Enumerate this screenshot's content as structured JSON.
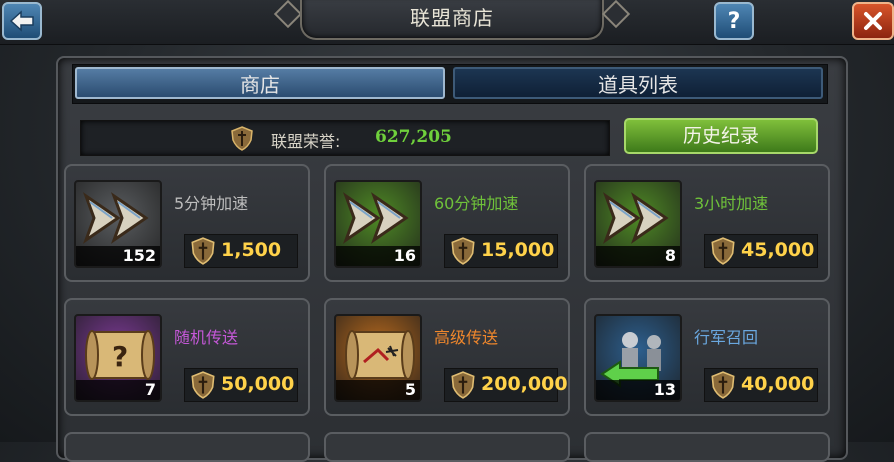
{
  "header": {
    "title": "联盟商店"
  },
  "tabs": [
    {
      "label": "商店",
      "active": true
    },
    {
      "label": "道具列表",
      "active": false
    }
  ],
  "honor": {
    "label": "联盟荣誉:",
    "value": "627,205"
  },
  "history_button": {
    "label": "历史纪录"
  },
  "colors": {
    "honor_value": "#6fd03c",
    "price": "#ffd24a",
    "tab_active": "#3e648c",
    "history": "#5f9f2c"
  },
  "items": [
    {
      "name": "5分钟加速",
      "price": "1,500",
      "quantity": "152",
      "icon": "fast-forward-icon",
      "name_color": "#bdbdbd",
      "bg": "#5a5d60"
    },
    {
      "name": "60分钟加速",
      "price": "15,000",
      "quantity": "16",
      "icon": "fast-forward-icon",
      "name_color": "#6fc23a",
      "bg": "#4f8a25"
    },
    {
      "name": "3小时加速",
      "price": "45,000",
      "quantity": "8",
      "icon": "fast-forward-icon",
      "name_color": "#6fc23a",
      "bg": "#4f8a25"
    },
    {
      "name": "随机传送",
      "price": "50,000",
      "quantity": "7",
      "icon": "scroll-question-icon",
      "name_color": "#c558d8",
      "bg": "#7b3a95"
    },
    {
      "name": "高级传送",
      "price": "200,000",
      "quantity": "5",
      "icon": "scroll-map-icon",
      "name_color": "#f0872c",
      "bg": "#b86a1e"
    },
    {
      "name": "行军召回",
      "price": "40,000",
      "quantity": "13",
      "icon": "march-recall-icon",
      "name_color": "#6aa8e0",
      "bg": "#2d5f8e"
    }
  ]
}
